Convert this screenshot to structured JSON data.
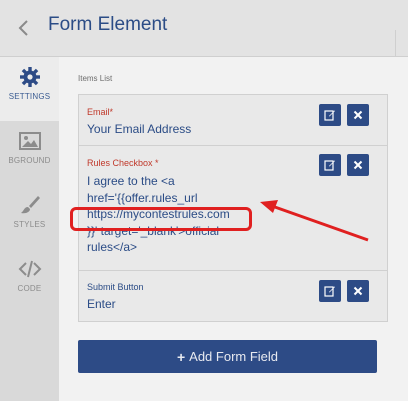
{
  "header": {
    "title": "Form Element",
    "back_icon": "chevron-left-icon"
  },
  "sidebar": {
    "items": [
      {
        "label": "SETTINGS",
        "icon": "gear-icon",
        "active": true
      },
      {
        "label": "BGROUND",
        "icon": "image-icon",
        "active": false
      },
      {
        "label": "STYLES",
        "icon": "brush-icon",
        "active": false
      },
      {
        "label": "CODE",
        "icon": "code-icon",
        "active": false
      }
    ]
  },
  "main": {
    "items_list_label": "Items List",
    "items": [
      {
        "label": "Email",
        "required_mark": "*",
        "value": "Your Email Address",
        "edit_icon": "edit-icon",
        "delete_icon": "close-icon"
      },
      {
        "label": "Rules Checkbox",
        "required_mark": "*",
        "value_lines": [
          "I agree to the <a",
          "href='{{offer.rules_url",
          "https://mycontestrules.com",
          "}}' target='_blank'>official",
          "rules</a>"
        ],
        "edit_icon": "edit-icon",
        "delete_icon": "close-icon"
      },
      {
        "label": "Submit Button",
        "required_mark": "",
        "value": "Enter",
        "edit_icon": "edit-icon",
        "delete_icon": "close-icon"
      }
    ],
    "add_button": {
      "plus": "+",
      "label": "Add Form Field"
    }
  },
  "colors": {
    "accent": "#2d4b86",
    "title": "#2b4c86",
    "required": "#c0392b",
    "annotation": "#e02020"
  }
}
